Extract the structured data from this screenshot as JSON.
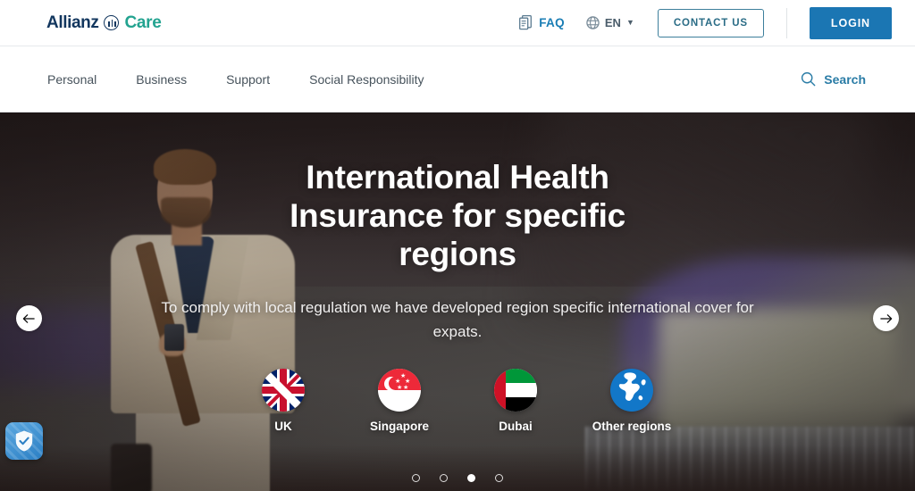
{
  "brand": {
    "name_primary": "Allianz",
    "name_secondary": "Care",
    "logo_icon": "allianz-bars-circle-icon",
    "color_primary": "#12365e",
    "color_secondary": "#23a390"
  },
  "topbar": {
    "faq": {
      "label": "FAQ",
      "icon": "document-stack-icon"
    },
    "language": {
      "label": "EN",
      "icon": "globe-icon",
      "chevron": "chevron-down-icon"
    },
    "contact_button": "CONTACT US",
    "login_button": "LOGIN",
    "colors": {
      "link": "#1b7eb5",
      "contact_border": "#3d7f9b",
      "login_bg": "#1b76b3"
    }
  },
  "mainnav": {
    "items": [
      {
        "label": "Personal"
      },
      {
        "label": "Business"
      },
      {
        "label": "Support"
      },
      {
        "label": "Social Responsibility"
      }
    ],
    "search": {
      "label": "Search",
      "icon": "search-icon",
      "color": "#2a7ca6"
    }
  },
  "hero": {
    "title": "International Health Insurance for specific regions",
    "subtitle": "To comply with local regulation we have developed region specific international cover for expats.",
    "regions": [
      {
        "label": "UK",
        "flag": "uk-flag-icon"
      },
      {
        "label": "Singapore",
        "flag": "singapore-flag-icon"
      },
      {
        "label": "Dubai",
        "flag": "uae-flag-icon"
      },
      {
        "label": "Other regions",
        "flag": "globe-icon"
      }
    ],
    "prev_arrow": "←",
    "next_arrow": "→",
    "slides": [
      {
        "active": false
      },
      {
        "active": false
      },
      {
        "active": true
      },
      {
        "active": false
      }
    ],
    "active_slide_index": 3,
    "slide_count": 4
  },
  "trust_badge": {
    "icon": "shield-check-icon"
  }
}
